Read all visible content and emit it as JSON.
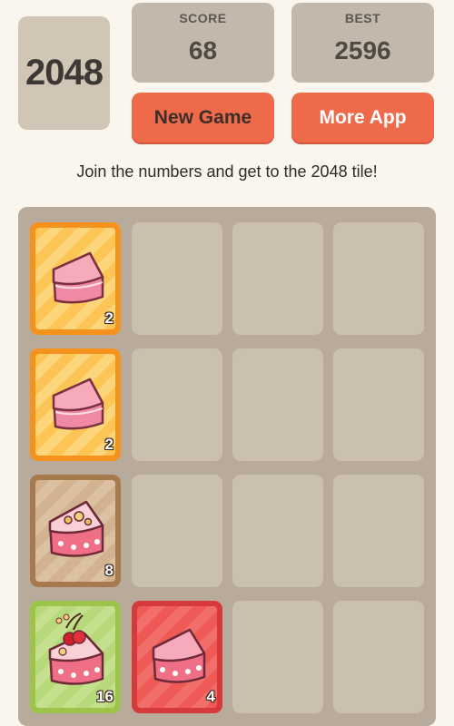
{
  "header": {
    "logo_text": "2048",
    "score": {
      "label": "SCORE",
      "value": "68"
    },
    "best": {
      "label": "BEST",
      "value": "2596"
    }
  },
  "buttons": {
    "new_game": "New Game",
    "more_app": "More App"
  },
  "tagline": "Join the numbers and get to the 2048 tile!",
  "board": {
    "rows": 4,
    "cols": 4,
    "tiles": [
      {
        "row": 0,
        "col": 0,
        "value": "2",
        "style": "plain-cake-slice"
      },
      {
        "row": 1,
        "col": 0,
        "value": "2",
        "style": "plain-cake-slice"
      },
      {
        "row": 2,
        "col": 0,
        "value": "8",
        "style": "frosted-cake-slice"
      },
      {
        "row": 3,
        "col": 0,
        "value": "16",
        "style": "cherry-cake-slice"
      },
      {
        "row": 3,
        "col": 1,
        "value": "4",
        "style": "dotted-cake-slice"
      }
    ]
  },
  "colors": {
    "background": "#faf6ee",
    "board": "#b8ab9c",
    "empty_cell": "#cbbfb0",
    "accent_button": "#ef6a4a",
    "tile_2": "#f5921e",
    "tile_4": "#d63a3a",
    "tile_8": "#a67a4d",
    "tile_16": "#9cc34a"
  }
}
